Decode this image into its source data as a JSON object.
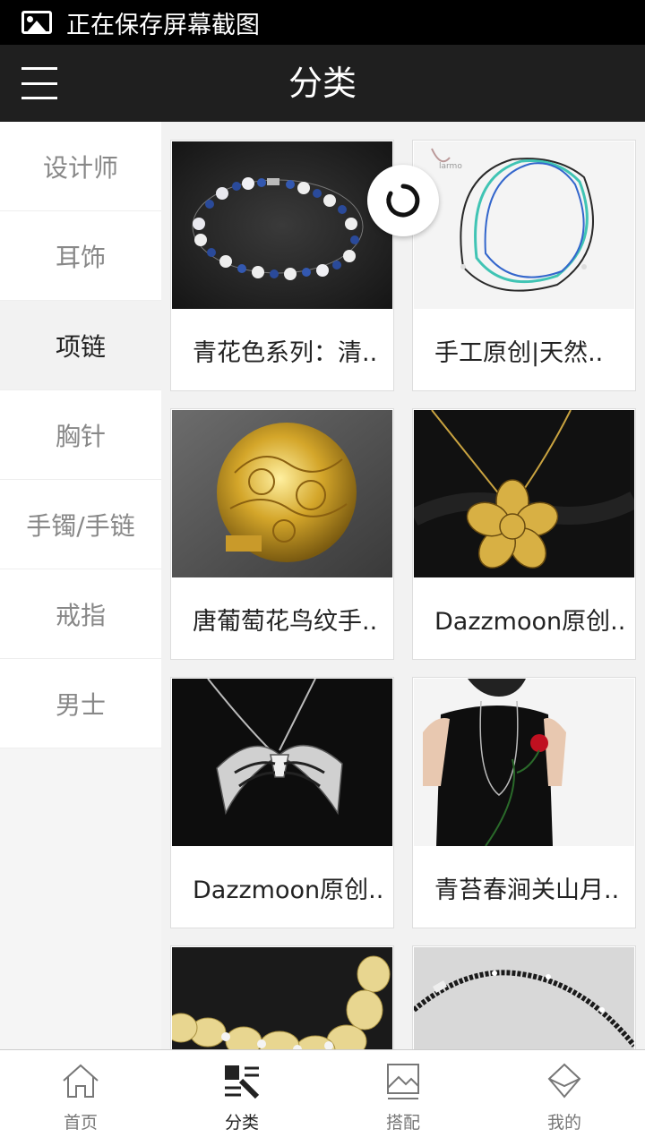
{
  "status_bar": {
    "text": "正在保存屏幕截图"
  },
  "header": {
    "title": "分类"
  },
  "sidebar": {
    "items": [
      {
        "label": "设计师",
        "active": false
      },
      {
        "label": "耳饰",
        "active": false
      },
      {
        "label": "项链",
        "active": true
      },
      {
        "label": "胸针",
        "active": false
      },
      {
        "label": "手镯/手链",
        "active": false
      },
      {
        "label": "戒指",
        "active": false
      },
      {
        "label": "男士",
        "active": false
      }
    ]
  },
  "products": [
    {
      "title": "青花色系列：清..",
      "image": "blue-white-pearl-bracelet"
    },
    {
      "title": "手工原创|天然..",
      "image": "turquoise-layered-necklace"
    },
    {
      "title": "唐葡萄花鸟纹手..",
      "image": "gold-filigree-ball"
    },
    {
      "title": "Dazzmoon原创..",
      "image": "gold-flower-pendant"
    },
    {
      "title": "Dazzmoon原创..",
      "image": "silver-bow-pendant"
    },
    {
      "title": "青苔春涧关山月..",
      "image": "model-long-necklace"
    },
    {
      "title": "",
      "image": "citrine-pearl-necklace"
    },
    {
      "title": "",
      "image": "black-bead-necklace"
    }
  ],
  "tabbar": {
    "tabs": [
      {
        "label": "首页",
        "icon": "home-icon",
        "active": false
      },
      {
        "label": "分类",
        "icon": "category-icon",
        "active": true
      },
      {
        "label": "搭配",
        "icon": "image-frame-icon",
        "active": false
      },
      {
        "label": "我的",
        "icon": "diamond-icon",
        "active": false
      }
    ]
  },
  "colors": {
    "header_bg": "#1f1f1f",
    "status_bg": "#000000",
    "active_text": "#222222",
    "inactive_text": "#888888"
  }
}
